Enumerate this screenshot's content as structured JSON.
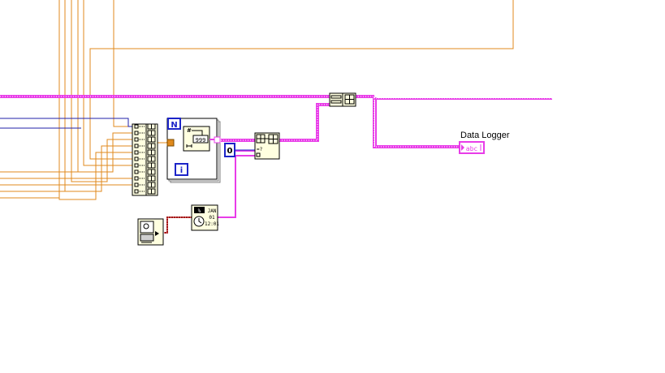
{
  "indicator": {
    "label": "Data Logger",
    "type_glyph": "abc"
  },
  "for_loop": {
    "count_terminal": "N",
    "iteration_terminal": "i"
  },
  "format_node": {
    "display": "999"
  },
  "constant": {
    "value": "0"
  },
  "datetime_node": {
    "month": "JAN",
    "day": "01",
    "time": "12:01"
  },
  "colors": {
    "numeric_wire": "#e08a1c",
    "string_wire": "#e83ce8",
    "cluster_wire": "#2222aa",
    "node_fill": "#ffffe0",
    "loop_border": "#7f7f7f",
    "terminal_blue": "#1c24c8",
    "timestamp_wire": "#a01414"
  },
  "icons": [
    "build-array-icon",
    "number-to-string-icon",
    "insert-into-array-icon",
    "build-array-small-icon",
    "format-date-time-icon",
    "get-datetime-icon"
  ]
}
